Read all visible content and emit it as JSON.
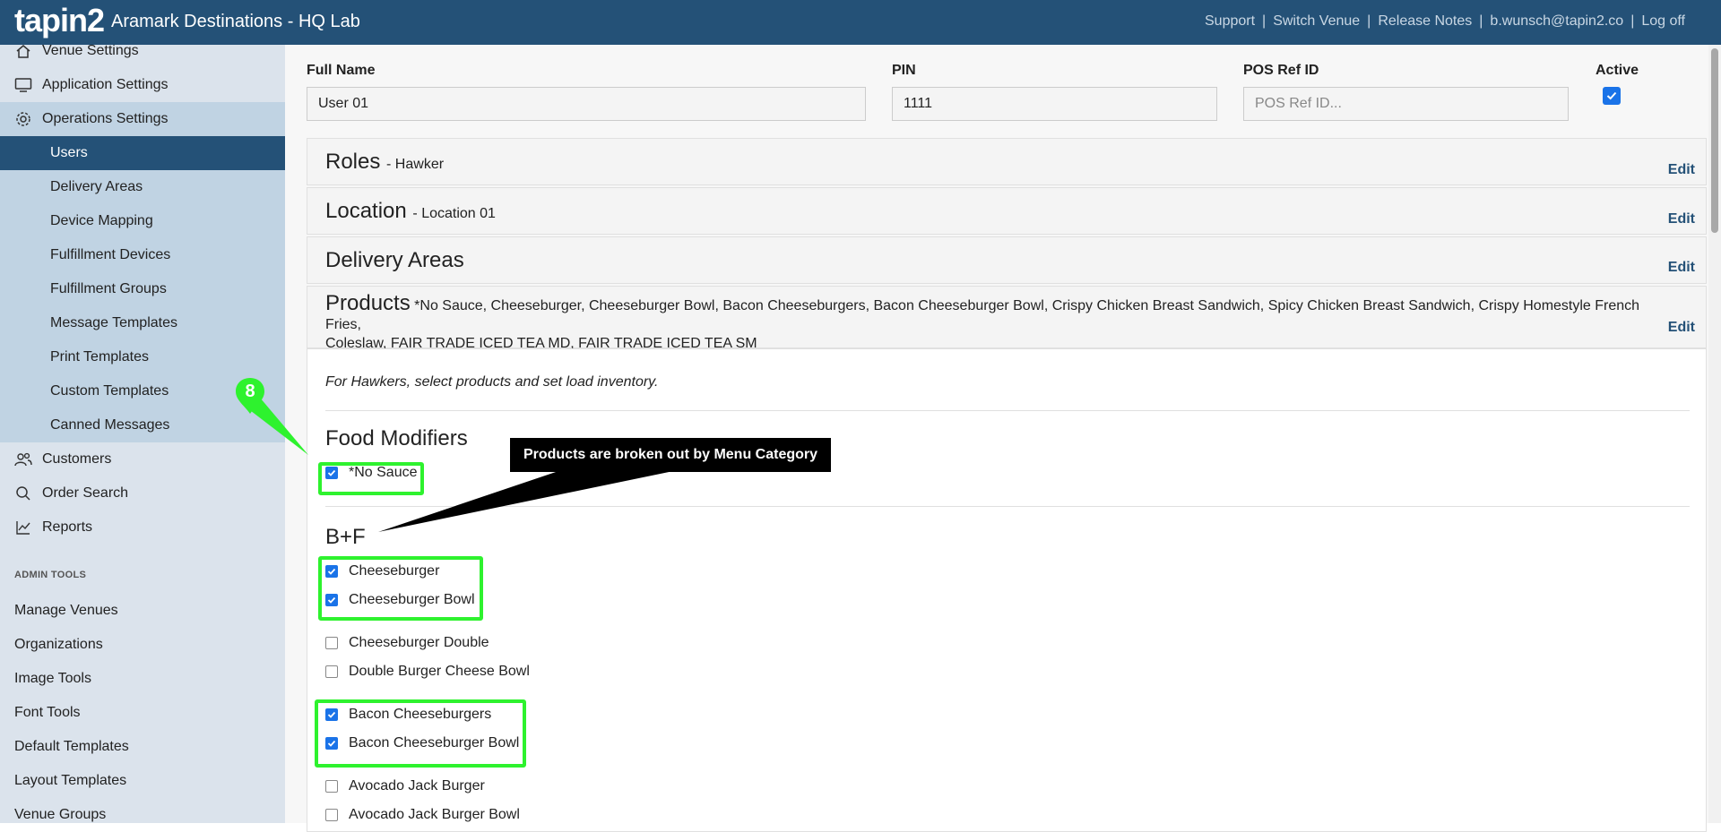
{
  "header": {
    "logo": "tapin2",
    "title": "Aramark Destinations - HQ Lab",
    "links": [
      "Support",
      "Switch Venue",
      "Release Notes",
      "b.wunsch@tapin2.co",
      "Log off"
    ],
    "separator": "|"
  },
  "sidebar": {
    "venue_settings": "Venue Settings",
    "application_settings": "Application Settings",
    "operations_settings": "Operations Settings",
    "ops_items": [
      "Users",
      "Delivery Areas",
      "Device Mapping",
      "Fulfillment Devices",
      "Fulfillment Groups",
      "Message Templates",
      "Print Templates",
      "Custom Templates",
      "Canned Messages"
    ],
    "customers": "Customers",
    "order_search": "Order Search",
    "reports": "Reports",
    "admin_header": "ADMIN TOOLS",
    "admin_items": [
      "Manage Venues",
      "Organizations",
      "Image Tools",
      "Font Tools",
      "Default Templates",
      "Layout Templates",
      "Venue Groups"
    ]
  },
  "form": {
    "full_name_label": "Full Name",
    "full_name_value": "User 01",
    "pin_label": "PIN",
    "pin_value": "1111",
    "pos_label": "POS Ref ID",
    "pos_placeholder": "POS Ref ID...",
    "active_label": "Active",
    "active_checked": true
  },
  "panels": {
    "roles_title": "Roles",
    "roles_value": "- Hawker",
    "location_title": "Location",
    "location_value": "- Location 01",
    "delivery_title": "Delivery Areas",
    "products_title": "Products",
    "products_value_line1": "*No Sauce, Cheeseburger, Cheeseburger Bowl, Bacon Cheeseburgers, Bacon Cheeseburger Bowl, Crispy Chicken Breast Sandwich, Spicy Chicken Breast Sandwich, Crispy Homestyle French Fries,",
    "products_value_line2": "Coleslaw, FAIR TRADE ICED TEA MD, FAIR TRADE ICED TEA SM",
    "edit_label": "Edit"
  },
  "products_body": {
    "hint": "For Hawkers, select products and set load inventory.",
    "food_modifiers_title": "Food Modifiers",
    "no_sauce": "*No Sauce",
    "bf_title": "B+F",
    "items": [
      {
        "label": "Cheeseburger",
        "checked": true
      },
      {
        "label": "Cheeseburger Bowl",
        "checked": true
      },
      {
        "label": "Cheeseburger Double",
        "checked": false
      },
      {
        "label": "Double Burger Cheese Bowl",
        "checked": false
      },
      {
        "label": "Bacon Cheeseburgers",
        "checked": true
      },
      {
        "label": "Bacon Cheeseburger Bowl",
        "checked": true
      },
      {
        "label": "Avocado Jack Burger",
        "checked": false
      },
      {
        "label": "Avocado Jack Burger Bowl",
        "checked": false
      }
    ]
  },
  "annotations": {
    "callout": "Products are broken out by Menu Category",
    "badge_number": "8",
    "highlight_color": "#2ef22e"
  },
  "colors": {
    "brand": "#245177",
    "checkbox": "#1a73e8",
    "sidebar_bg": "#dbe3ec",
    "sidebar_sub_bg": "#c0d3e3"
  }
}
